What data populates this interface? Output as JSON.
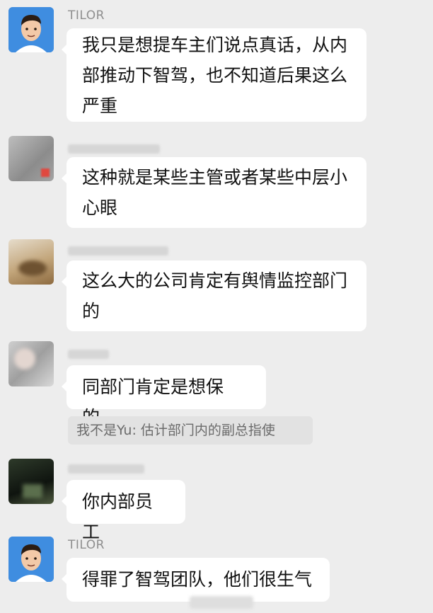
{
  "messages": [
    {
      "sender": "TILOR",
      "lines": [
        "我只是想提车主们说点真话，从内",
        "部推动下智驾，也不知道后果这么",
        "严重"
      ],
      "avatar": "cartoon-man-avatar"
    },
    {
      "sender": "",
      "lines": [
        "这种就是某些主管或者某些中层小",
        "心眼"
      ],
      "avatar": "blurred-avatar"
    },
    {
      "sender": "",
      "lines": [
        "这么大的公司肯定有舆情监控部门",
        "的"
      ],
      "avatar": "blurred-avatar"
    },
    {
      "sender": "",
      "lines": [
        "同部门肯定是想保的，"
      ],
      "avatar": "blurred-avatar"
    },
    {
      "quote": "我不是Yu: 估计部门内的副总指使"
    },
    {
      "sender": "",
      "lines": [
        "你内部员工"
      ],
      "avatar": "blurred-avatar"
    },
    {
      "sender": "TILOR",
      "lines": [
        "得罪了智驾团队，他们很生气"
      ],
      "avatar": "cartoon-man-avatar"
    }
  ]
}
